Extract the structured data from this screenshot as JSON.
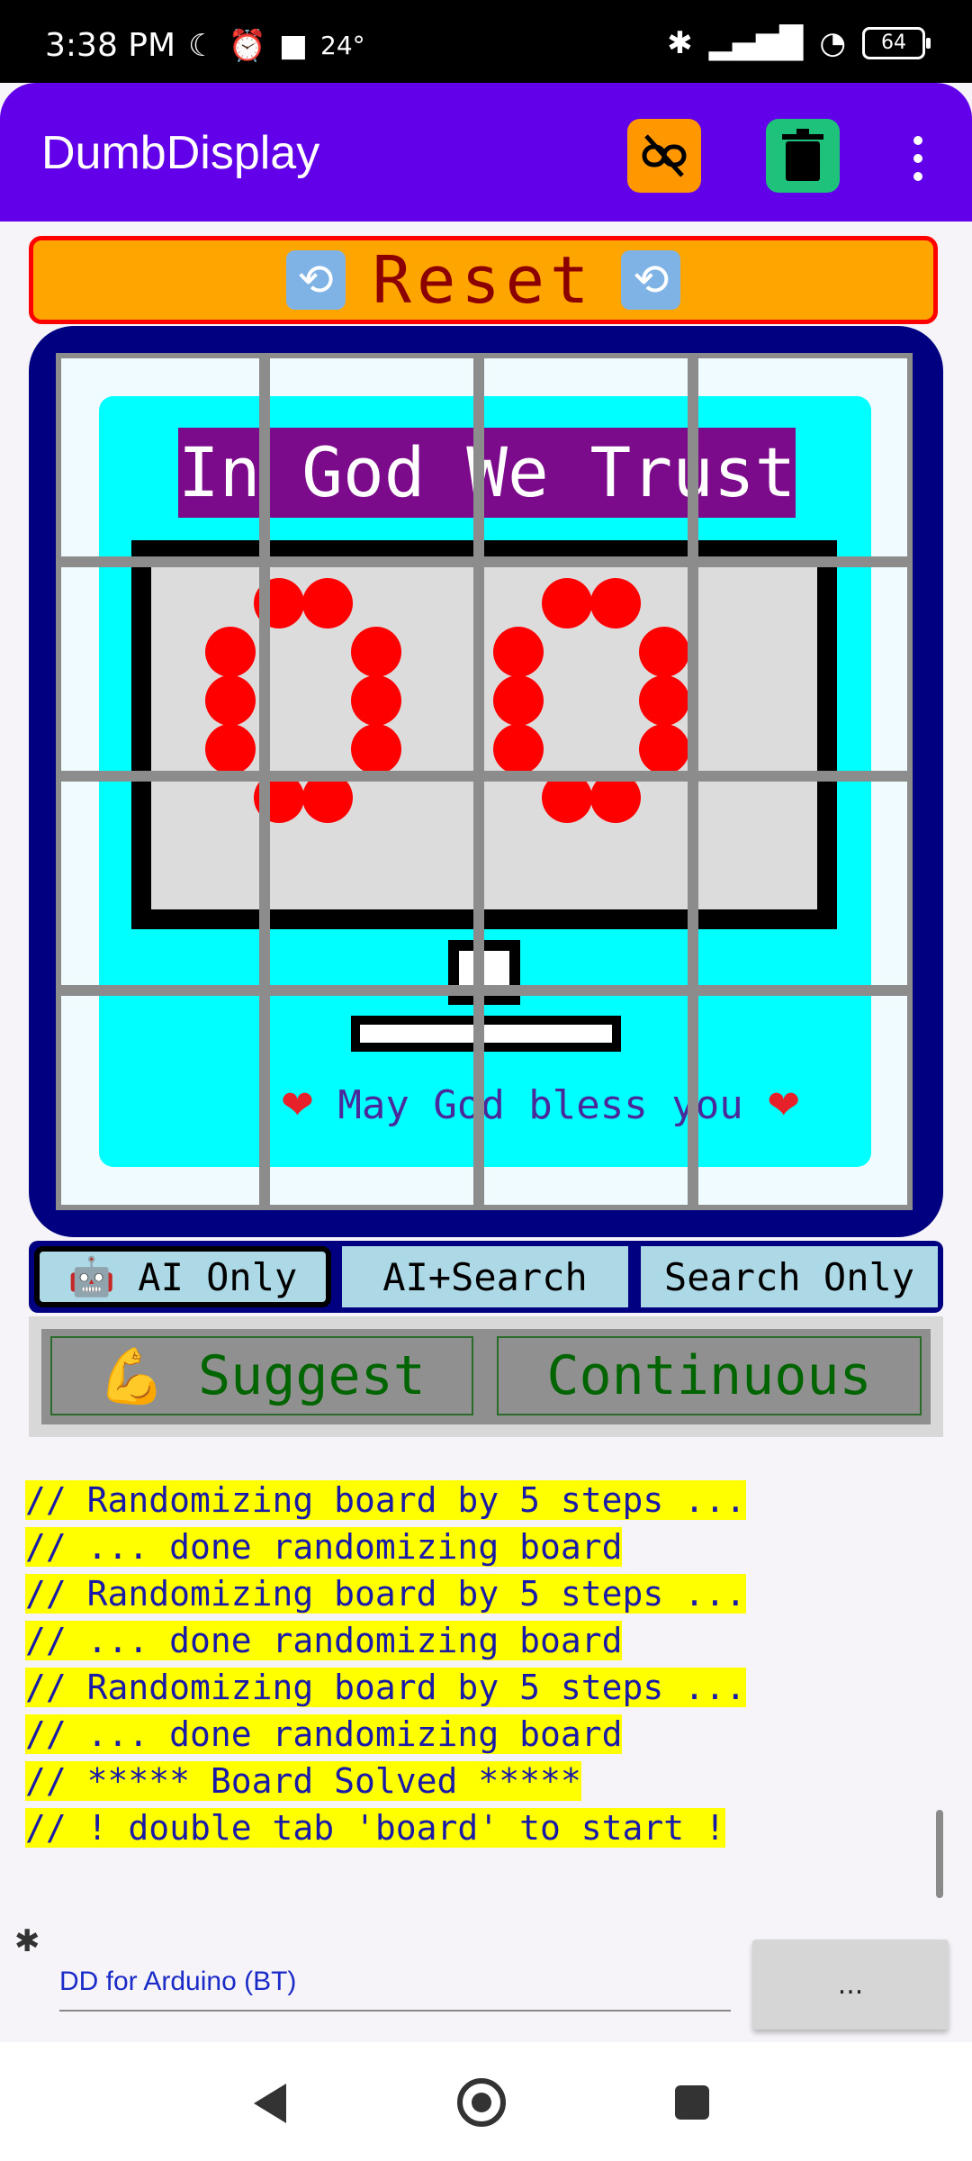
{
  "status_bar": {
    "time": "3:38 PM",
    "temperature": "24°",
    "battery": "64",
    "icons": [
      "moon-icon",
      "alarm-icon",
      "video-icon",
      "bluetooth-icon",
      "signal-icon",
      "wifi-icon",
      "battery-icon"
    ]
  },
  "app_bar": {
    "title": "DumbDisplay",
    "unlink_button_color": "#ff9800",
    "delete_button_color": "#1ec27a",
    "background": "#6200ea"
  },
  "reset": {
    "label": "Reset",
    "left_icon": "cycle-arrows-icon",
    "right_icon": "cycle-arrows-icon",
    "background": "#ffa500",
    "border": "#ff0000",
    "text_color": "#8b0000"
  },
  "board": {
    "banner": "In God We Trust",
    "blessing_text": "May God bless you",
    "heart": "❤",
    "display_digits": "00",
    "grid_size": "4x4"
  },
  "modes": {
    "items": [
      {
        "icon": "🤖",
        "label": "AI Only",
        "selected": true
      },
      {
        "label": "AI+Search",
        "selected": false
      },
      {
        "label": "Search Only",
        "selected": false
      }
    ]
  },
  "actions": {
    "suggest_icon": "💪",
    "suggest_label": "Suggest",
    "continuous_label": "Continuous"
  },
  "log": {
    "lines": [
      "// Randomizing board by 5 steps ...",
      "// ... done randomizing board",
      "// Randomizing board by 5 steps ...",
      "// ... done randomizing board",
      "// Randomizing board by 5 steps ...",
      "// ... done randomizing board",
      "// ***** Board Solved *****",
      "// ! double tab 'board' to start !"
    ]
  },
  "connection": {
    "label": "DD for Arduino (BT)",
    "button_label": "..."
  }
}
